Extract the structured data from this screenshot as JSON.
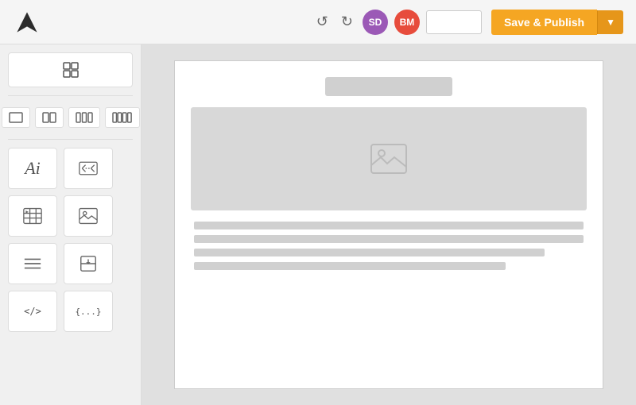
{
  "topbar": {
    "undo_label": "↺",
    "redo_label": "↻",
    "avatar_sd": "SD",
    "avatar_bm": "BM",
    "input_placeholder": "",
    "save_publish_label": "Save & Publish",
    "arrow_label": "▼"
  },
  "sidebar": {
    "top_btn_title": "templates",
    "layout_options": [
      "□",
      "⊟",
      "⊞",
      "⊠"
    ],
    "tools": [
      {
        "id": "text",
        "label": "Ai"
      },
      {
        "id": "embed",
        "label": "embed"
      },
      {
        "id": "table",
        "label": "table"
      },
      {
        "id": "image-gallery",
        "label": "gallery"
      },
      {
        "id": "align",
        "label": "align"
      },
      {
        "id": "divider",
        "label": "divider"
      },
      {
        "id": "code",
        "label": "</>"
      },
      {
        "id": "json",
        "label": "{...}"
      }
    ]
  },
  "canvas": {
    "title_placeholder": "",
    "image_placeholder": "🖼",
    "text_lines": [
      "full",
      "full",
      "medium",
      "short"
    ]
  }
}
